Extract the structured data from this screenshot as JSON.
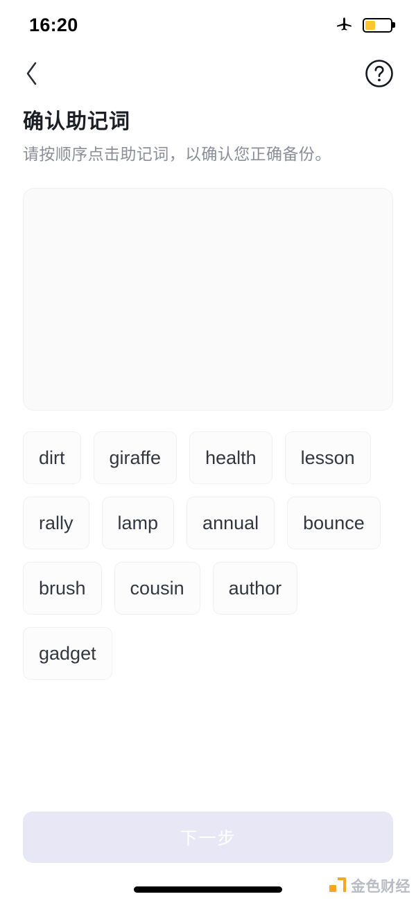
{
  "status_bar": {
    "time": "16:20",
    "airplane_icon": "airplane-mode-icon",
    "battery_icon": "battery-low-icon",
    "battery_level_percent": 40,
    "battery_color": "#fdc62e"
  },
  "nav": {
    "back_icon": "chevron-left-icon",
    "help_icon": "question-circle-icon"
  },
  "heading": {
    "title": "确认助记词",
    "subtitle": "请按顺序点击助记词，以确认您正确备份。"
  },
  "answer_box": {
    "selected_words": [],
    "background_color": "#fafafa"
  },
  "word_pool": {
    "words": [
      "dirt",
      "giraffe",
      "health",
      "lesson",
      "rally",
      "lamp",
      "annual",
      "bounce",
      "brush",
      "cousin",
      "author",
      "gadget"
    ]
  },
  "footer": {
    "next_label": "下一步",
    "next_enabled": false,
    "next_background": "#e7e7f6"
  },
  "watermark": {
    "text": "金色财经",
    "accent_color": "#f5a623"
  }
}
